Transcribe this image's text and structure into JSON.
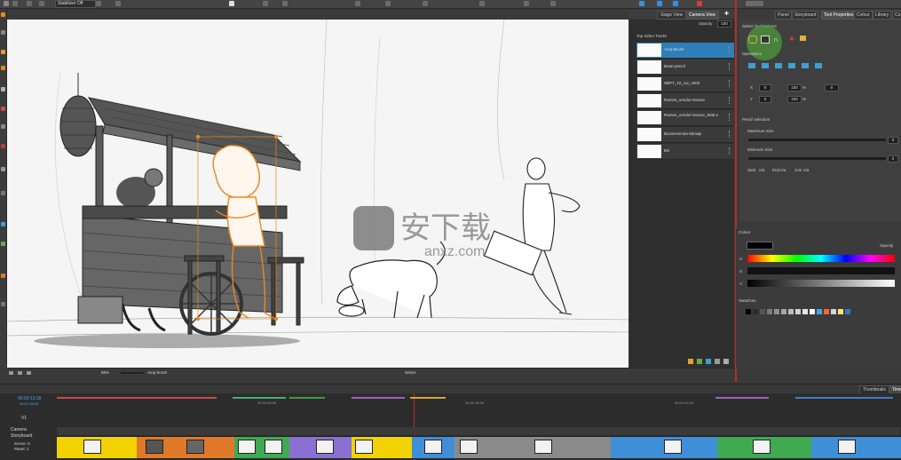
{
  "toolbar": {
    "stabilizer_select": "Stabilizer Off"
  },
  "view_tabs": {
    "stage_view": "Stage View",
    "camera_view": "Camera View"
  },
  "layers_panel": {
    "opacity_label": "Opacity",
    "opacity_value": "100",
    "group_title": "Top Video Tracks",
    "layers": [
      {
        "name": "Amp-Brush",
        "selected": true
      },
      {
        "name": "Bean-pencil",
        "selected": false
      },
      {
        "name": "SBPT_10_cur_v003",
        "selected": false
      },
      {
        "name": "Ramen_vendor-texture",
        "selected": false
      },
      {
        "name": "Ramen_vendor-texture_Matt e",
        "selected": false
      },
      {
        "name": "Businessman-bitmap",
        "selected": false
      },
      {
        "name": "BG",
        "selected": false
      }
    ]
  },
  "right_tabs": [
    "Panel",
    "Storyboard",
    "Tool Properties",
    "Colour",
    "Library",
    "Cu"
  ],
  "tool_properties": {
    "select_tool_options": "Select Tool Options",
    "operations": "Operations",
    "x_label": "X",
    "y_label": "Y",
    "x_value": "0",
    "y_value": "0",
    "width_value": "100",
    "height_value": "100",
    "percent": "%",
    "angle_value": "0",
    "pencil_selection": "Pencil selection",
    "maximum_size": "Maximum Size",
    "minimum_size": "Minimum Size",
    "max_value": "0",
    "min_value": "0",
    "start_label": "Start",
    "end_label": "End",
    "join_label": "Join",
    "na": "n/a"
  },
  "colour_panel": {
    "title": "Colour",
    "opacity_label": "Opacity",
    "h_label": "H",
    "s_label": "S",
    "v_label": "V",
    "swatches_title": "Swatches",
    "swatch_colors": [
      "#000000",
      "#2b2b2b",
      "#555555",
      "#7a7a7a",
      "#8f8f8f",
      "#a5a5a5",
      "#bcbcbc",
      "#d0d0d0",
      "#e6e6e6",
      "#ffffff",
      "#4aa3df",
      "#f06a2a",
      "#d4d4d4",
      "#f7e27a",
      "#3476c0"
    ]
  },
  "view_controls": {
    "zoom": "88%",
    "layer_name": "Amp-brush",
    "mode": "Select"
  },
  "timeline": {
    "timecode": "00:00:13:18",
    "timecode_sub": "00:01:48:03",
    "tick1": "00:00:08:00",
    "tick2": "00:00:16:00",
    "tick3": "00:00:24:00",
    "v1": "V1",
    "camera": "Camera",
    "storyboard": "Storyboard",
    "scene": "Scene: 6",
    "panel": "Panel: 1",
    "thumbnails_tab": "Thumbnails",
    "timeline_tab": "Timel"
  },
  "watermark": {
    "cn": "安下载",
    "url": "anxz.com"
  },
  "colors": {
    "selection_orange": "#e8891f",
    "accent_blue": "#2e7fb8"
  }
}
